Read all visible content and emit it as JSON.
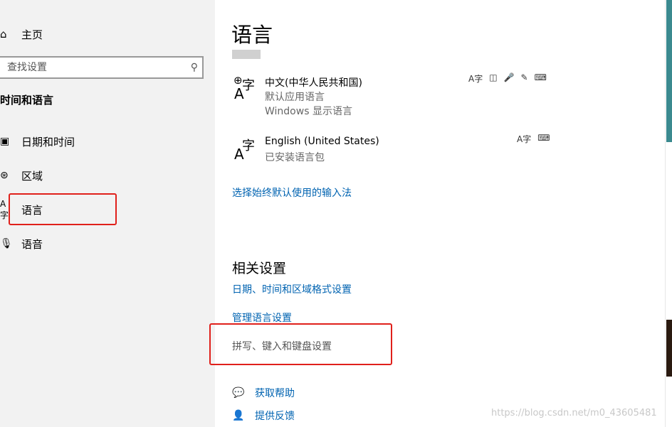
{
  "sidebar": {
    "home_label": "主页",
    "search_placeholder": "查找设置",
    "section_title": "时间和语言",
    "items": [
      {
        "label": "日期和时间",
        "icon": "calendar-clock-icon"
      },
      {
        "label": "区域",
        "icon": "globe-region-icon"
      },
      {
        "label": "语言",
        "icon": "language-icon"
      },
      {
        "label": "语音",
        "icon": "microphone-icon"
      }
    ]
  },
  "main": {
    "title": "语言",
    "languages": [
      {
        "name": "中文(中华人民共和国)",
        "line1": "默认应用语言",
        "line2": "Windows 显示语言"
      },
      {
        "name": "English (United States)",
        "line1": "已安装语言包"
      }
    ],
    "default_input_link": "选择始终默认使用的输入法",
    "related_title": "相关设置",
    "related_links": [
      "日期、时间和区域格式设置",
      "管理语言设置"
    ],
    "highlighted_setting": "拼写、键入和键盘设置",
    "help_link": "获取帮助",
    "feedback_link": "提供反馈"
  },
  "watermark": "https://blog.csdn.net/m0_43605481",
  "colors": {
    "accent": "#0063b1",
    "highlight": "#e0201b",
    "sidebar_bg": "#f2f2f2"
  }
}
